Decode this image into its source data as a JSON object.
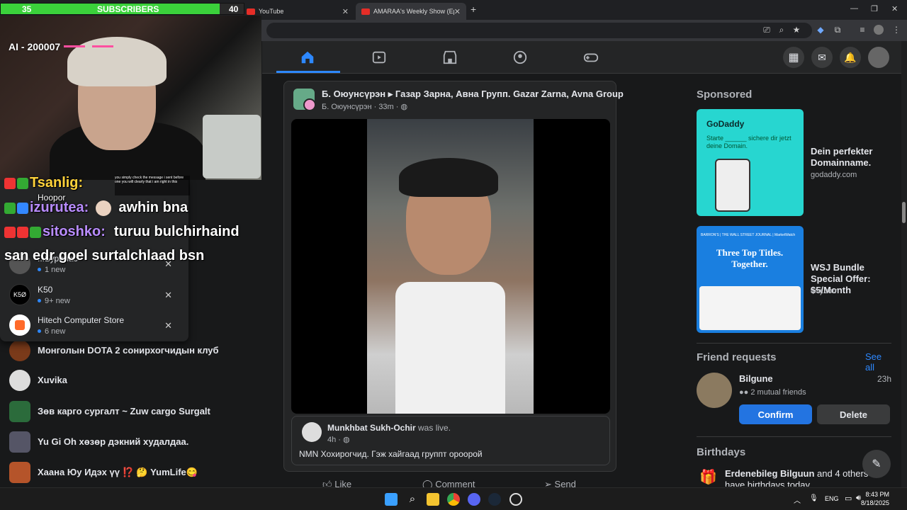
{
  "browser": {
    "tabs": [
      {
        "label": "YouTube"
      },
      {
        "label": "AMARAA's Weekly Show (Episo"
      }
    ]
  },
  "stream": {
    "subs_left": "35",
    "subs_label": "SUBSCRIBERS",
    "subs_right": "40",
    "subs_progress": 0.9,
    "ai_text": "AI - 200007",
    "chat": [
      {
        "user": "Tsanlig:",
        "msg": ""
      },
      {
        "user": "Hoopor",
        "msg": ""
      },
      {
        "user": "izurutea:",
        "msg": "awhin bna"
      },
      {
        "user": "sitoshko:",
        "msg": "turuu bulchirhaind"
      },
      {
        "user": "",
        "msg": "san edr goel surtalchlaad bsn"
      }
    ],
    "small_msg": "you simply check the message i sent before one you will clearly that i am right in this"
  },
  "notif_popup": {
    "items": [
      {
        "name": "...Бурилас",
        "count": "1 new"
      },
      {
        "name": "K50",
        "count": "9+ new"
      },
      {
        "name": "Hitech Computer Store",
        "count": "6 new"
      }
    ]
  },
  "sidebar": {
    "items": [
      {
        "name": "Монголын DOTA 2 сонирхогчидын клуб"
      },
      {
        "name": "Xuvika"
      },
      {
        "name": "Зөв карго сургалт ~ Zuw cargo Surgalt"
      },
      {
        "name": "Yu Gi Oh хөзөр дэкний худалдаа."
      },
      {
        "name": "Хаана Юу Идэх үү ⁉️ 🤔 YumLife😋"
      }
    ]
  },
  "post": {
    "author": "Б. Оюунсүрэн",
    "arrow": "▸",
    "group": "Газар Зарна, Авна Групп. Gazar Zarna, Avna Group",
    "sub_author": "Б. Оюунсүрэн",
    "time": "33m",
    "shared_author": "Munkhbat Sukh-Ochir",
    "shared_action": "was live.",
    "shared_time": "4h",
    "shared_text": "NMN Хохирогчид.  Гэж хайгаад группт ороорой",
    "like": "Like",
    "comment": "Comment",
    "send": "Send"
  },
  "right": {
    "sponsored": "Sponsored",
    "ads": [
      {
        "title": "Dein perfekter Domainname.",
        "url": "godaddy.com",
        "brand": "GoDaddy",
        "tagline": "Starte ______ sichere dir jetzt deine Domain."
      },
      {
        "title": "WSJ Bundle Special Offer: $5/Month",
        "url": "wsj.com",
        "brand": "BARRON'S | THE WALL STREET JOURNAL | MarketWatch",
        "tagline": "Three Top Titles. Together."
      }
    ],
    "friend_requests": "Friend requests",
    "see_all": "See all",
    "friend": {
      "name": "Bilgune",
      "time": "23h",
      "mutual": "2 mutual friends"
    },
    "confirm": "Confirm",
    "delete": "Delete",
    "birthdays": "Birthdays",
    "birthday_text_bold": "Erdenebileg Bilguun",
    "birthday_text": " and 4 others have birthdays today."
  },
  "taskbar": {
    "lang": "ENG",
    "time": "8:43 PM",
    "date": "8/18/2025"
  },
  "colors": {
    "accent": "#2d88ff",
    "fb_bg": "#18191a",
    "card": "#242526",
    "sub_green": "#3bd13b"
  }
}
